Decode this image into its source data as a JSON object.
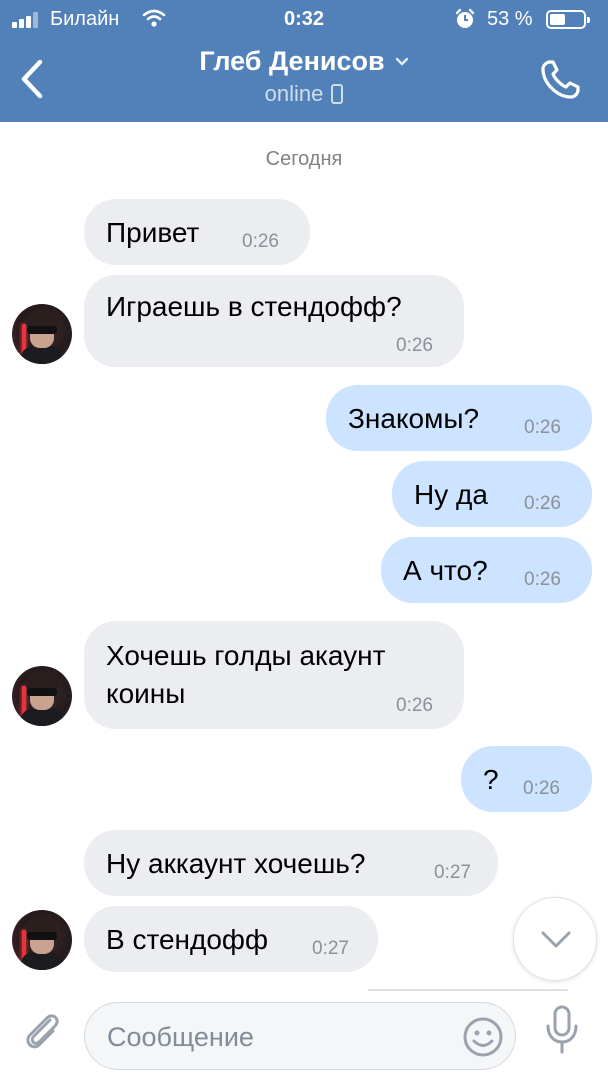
{
  "status_bar": {
    "carrier": "Билайн",
    "time": "0:32",
    "battery_percent": "53 %",
    "battery_level": 0.53
  },
  "header": {
    "contact_name": "Глеб Денисов",
    "presence": "online"
  },
  "chat": {
    "date_separator": "Сегодня",
    "messages": [
      {
        "direction": "in",
        "text": "Привет",
        "time": "0:26"
      },
      {
        "direction": "in",
        "text": "Играешь в стендофф?",
        "time": "0:26"
      },
      {
        "direction": "out",
        "text": "Знакомы?",
        "time": "0:26"
      },
      {
        "direction": "out",
        "text": "Ну да",
        "time": "0:26"
      },
      {
        "direction": "out",
        "text": "А что?",
        "time": "0:26"
      },
      {
        "direction": "in",
        "text": "Хочешь голды акаунт\nкоины",
        "time": "0:26"
      },
      {
        "direction": "out",
        "text": "?",
        "time": "0:26"
      },
      {
        "direction": "in",
        "text": "Ну аккаунт хочешь?",
        "time": "0:27"
      },
      {
        "direction": "in",
        "text": "В стендофф",
        "time": "0:27"
      }
    ]
  },
  "composer": {
    "placeholder": "Сообщение"
  },
  "icons": [
    "signal-icon",
    "wifi-icon",
    "alarm-icon",
    "battery-icon",
    "back-arrow-icon",
    "chevron-down-icon",
    "mobile-icon",
    "phone-call-icon",
    "scroll-down-icon",
    "attach-icon",
    "emoji-icon",
    "microphone-icon"
  ],
  "colors": {
    "header_bg": "#5181b8",
    "incoming_bubble": "#ebedf0",
    "outgoing_bubble": "#cce4ff",
    "time_text": "#8a9199"
  }
}
